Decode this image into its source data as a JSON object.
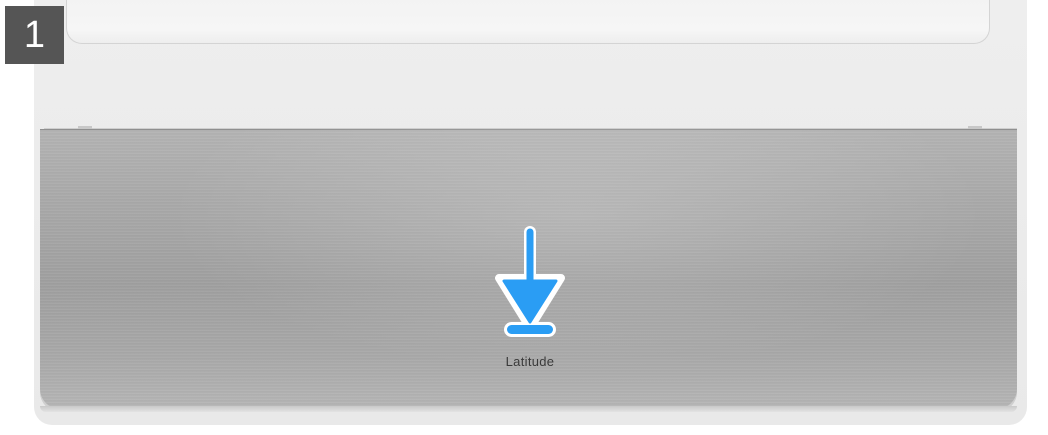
{
  "step": {
    "number": "1"
  },
  "laptop": {
    "brand_text": "Latitude"
  },
  "annotation": {
    "arrow_icon": "arrow-down-icon",
    "arrow_color": "#2a9df4",
    "arrow_outline": "#ffffff"
  },
  "colors": {
    "badge_background": "#555555",
    "badge_text": "#ffffff",
    "chassis": "#ececec",
    "metal_panel": "#a6a6a6"
  }
}
